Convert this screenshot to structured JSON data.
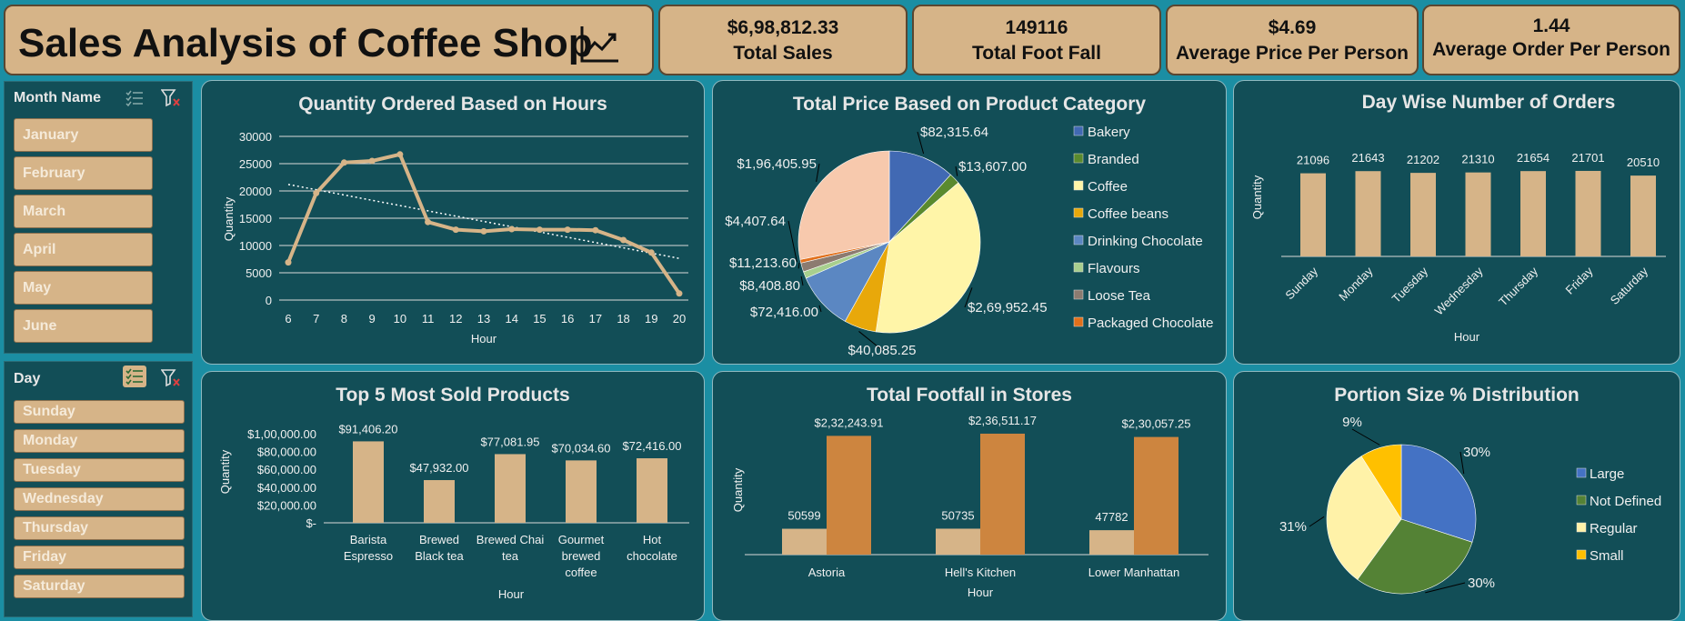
{
  "header": {
    "title": "Sales Analysis of Coffee Shop",
    "icon": "trend-line-chart-icon"
  },
  "kpis": [
    {
      "value": "$6,98,812.33",
      "label": "Total Sales"
    },
    {
      "value": "149116",
      "label": "Total Foot Fall"
    },
    {
      "value": "$4.69",
      "label": "Average Price Per Person"
    },
    {
      "value": "1.44",
      "label": "Average Order Per Person"
    }
  ],
  "month_slicer": {
    "title": "Month Name",
    "items": [
      "January",
      "February",
      "March",
      "April",
      "May",
      "June"
    ]
  },
  "day_slicer": {
    "title": "Day",
    "items": [
      "Sunday",
      "Monday",
      "Tuesday",
      "Wednesday",
      "Thursday",
      "Friday",
      "Saturday"
    ]
  },
  "colors": {
    "background": "#1b8ea3",
    "panel": "#124e57",
    "tan": "#d6b488",
    "orange": "#cd853f"
  },
  "chart_data": [
    {
      "type": "line",
      "title": "Quantity Ordered Based on Hours",
      "xlabel": "Hour",
      "ylabel": "Quantity",
      "x": [
        6,
        7,
        8,
        9,
        10,
        11,
        12,
        13,
        14,
        15,
        16,
        17,
        18,
        19,
        20
      ],
      "values": [
        6900,
        19600,
        25200,
        25500,
        26700,
        14300,
        12900,
        12600,
        13000,
        12900,
        12900,
        12800,
        11000,
        8700,
        1200
      ],
      "yticks": [
        "0",
        "5000",
        "10000",
        "15000",
        "20000",
        "25000",
        "30000"
      ],
      "ylim": [
        0,
        30000
      ],
      "trendline": "linear",
      "grid": true
    },
    {
      "type": "pie",
      "title": "Total Price Based on Product Category",
      "legend_position": "right",
      "slices": [
        {
          "name": "Bakery",
          "value": 82315.64,
          "label": "$82,315.64",
          "color": "#4169b3"
        },
        {
          "name": "Branded",
          "value": 13607.0,
          "label": "$13,607.00",
          "color": "#5a8a2e"
        },
        {
          "name": "Coffee",
          "value": 269952.45,
          "label": "$2,69,952.45",
          "color": "#fff5a8"
        },
        {
          "name": "Coffee beans",
          "value": 40085.25,
          "label": "$40,085.25",
          "color": "#e8a80a"
        },
        {
          "name": "Drinking Chocolate",
          "value": 72416.0,
          "label": "$72,416.00",
          "color": "#5b87c2"
        },
        {
          "name": "Flavours",
          "value": 8408.8,
          "label": "$8,408.80",
          "color": "#a8cf8e"
        },
        {
          "name": "Loose Tea",
          "value": 11213.6,
          "label": "$11,213.60",
          "color": "#8c7b70"
        },
        {
          "name": "Packaged Chocolate",
          "value": 4407.64,
          "label": "$4,407.64",
          "color": "#e2701b"
        },
        {
          "name": "",
          "value": 196405.95,
          "label": "$1,96,405.95",
          "color": "#f7c9ad"
        }
      ]
    },
    {
      "type": "bar",
      "title": "Day Wise Number of Orders",
      "xlabel": "Hour",
      "ylabel": "Quantity",
      "categories": [
        "Sunday",
        "Monday",
        "Tuesday",
        "Wednesday",
        "Thursday",
        "Friday",
        "Saturday"
      ],
      "values": [
        21096,
        21643,
        21202,
        21310,
        21654,
        21701,
        20510
      ],
      "value_labels": [
        "21096",
        "21643",
        "21202",
        "21310",
        "21654",
        "21701",
        "20510"
      ]
    },
    {
      "type": "bar",
      "title": "Top 5 Most Sold Products",
      "xlabel": "Hour",
      "ylabel": "Quantity",
      "categories": [
        [
          "Barista",
          "Espresso"
        ],
        [
          "Brewed",
          "Black tea"
        ],
        [
          "Brewed Chai",
          "tea"
        ],
        [
          "Gourmet",
          "brewed",
          "coffee"
        ],
        [
          "Hot",
          "chocolate"
        ]
      ],
      "values": [
        91406.2,
        47932.0,
        77081.95,
        70034.6,
        72416.0
      ],
      "value_labels": [
        "$91,406.20",
        "$47,932.00",
        "$77,081.95",
        "$70,034.60",
        "$72,416.00"
      ],
      "yticks": [
        "$-",
        "$20,000.00",
        "$40,000.00",
        "$60,000.00",
        "$80,000.00",
        "$1,00,000.00"
      ],
      "ylim": [
        0,
        100000
      ]
    },
    {
      "type": "bar",
      "title": "Total Footfall in Stores",
      "xlabel": "Hour",
      "ylabel": "Quantity",
      "categories": [
        "Astoria",
        "Hell's Kitchen",
        "Lower Manhattan"
      ],
      "series": [
        {
          "values": [
            50599,
            50735,
            47782
          ],
          "value_labels": [
            "50599",
            "50735",
            "47782"
          ],
          "color": "#d6b488"
        },
        {
          "values": [
            232243.91,
            236511.17,
            230057.25
          ],
          "value_labels": [
            "$2,32,243.91",
            "$2,36,511.17",
            "$2,30,057.25"
          ],
          "color": "#cd853f"
        }
      ]
    },
    {
      "type": "pie",
      "title": "Portion Size % Distribution",
      "legend_position": "right",
      "slices": [
        {
          "name": "Large",
          "value": 30,
          "label": "30%",
          "color": "#4472c4"
        },
        {
          "name": "Not Defined",
          "value": 30,
          "label": "30%",
          "color": "#548235"
        },
        {
          "name": "Regular",
          "value": 31,
          "label": "31%",
          "color": "#fff2a8"
        },
        {
          "name": "Small",
          "value": 9,
          "label": "9%",
          "color": "#ffc000"
        }
      ]
    }
  ]
}
